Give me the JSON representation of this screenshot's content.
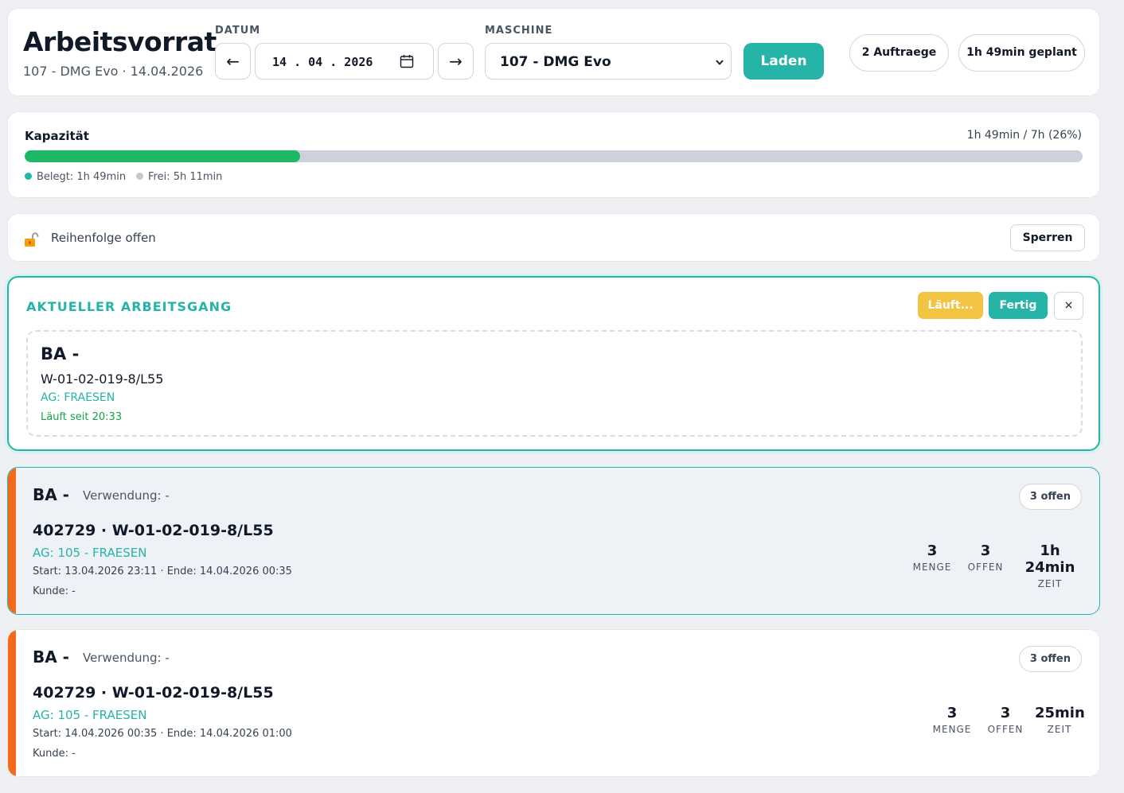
{
  "header": {
    "title": "Arbeitsvorrat",
    "subtitle": "107 - DMG Evo · 14.04.2026",
    "date_label": "DATUM",
    "date_value": "14 . 04 . 2026",
    "prev_arrow": "←",
    "next_arrow": "→",
    "machine_label": "MASCHINE",
    "machine_value": "107 - DMG Evo",
    "load_button": "Laden",
    "orders_pill": "2 Auftraege",
    "planned_pill": "1h 49min geplant",
    "accent_color": "#26b3a8"
  },
  "capacity": {
    "title": "Kapazität",
    "summary": "1h 49min / 7h (26%)",
    "fill_percent": 26,
    "used_label": "Belegt: 1h 49min",
    "free_label": "Frei: 5h 11min",
    "used_color": "#1db864",
    "free_color": "#cdd2da"
  },
  "lock": {
    "icon": "unlocked-padlock-icon",
    "text": "Reihenfolge offen",
    "button": "Sperren"
  },
  "current": {
    "title": "AKTUELLER ARBEITSGANG",
    "running_button": "Läuft...",
    "done_button": "Fertig",
    "close_button": "×",
    "ba": "BA -",
    "article": "W-01-02-019-8/L55",
    "ag": "AG: FRAESEN",
    "since": "Läuft seit 20:33",
    "running_color": "#f3c342"
  },
  "orders": [
    {
      "ba": "BA -",
      "use": "Verwendung: -",
      "badge": "3 offen",
      "order": "402729 · W-01-02-019-8/L55",
      "ag": "AG: 105 - FRAESEN",
      "times": "Start: 13.04.2026 23:11 · Ende: 14.04.2026 00:35",
      "customer": "Kunde: -",
      "menge": "3",
      "menge_label": "MENGE",
      "offen": "3",
      "offen_label": "OFFEN",
      "zeit": "1h 24min",
      "zeit_label": "ZEIT"
    },
    {
      "ba": "BA -",
      "use": "Verwendung: -",
      "badge": "3 offen",
      "order": "402729 · W-01-02-019-8/L55",
      "ag": "AG: 105 - FRAESEN",
      "times": "Start: 14.04.2026 00:35 · Ende: 14.04.2026 01:00",
      "customer": "Kunde: -",
      "menge": "3",
      "menge_label": "MENGE",
      "offen": "3",
      "offen_label": "OFFEN",
      "zeit": "25min",
      "zeit_label": "ZEIT"
    }
  ]
}
